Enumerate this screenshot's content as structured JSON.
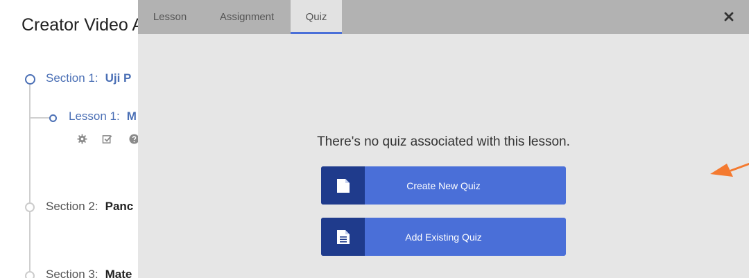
{
  "background": {
    "page_title": "Creator Video A",
    "sections": [
      {
        "label": "Section 1:",
        "name": "Uji P"
      },
      {
        "label": "Section 2:",
        "name": "Panc"
      },
      {
        "label": "Section 3:",
        "name": "Mate"
      }
    ],
    "lesson": {
      "label": "Lesson 1:",
      "name": "M"
    },
    "lesson_tools": [
      "gear-icon",
      "checkbox-icon",
      "help-icon"
    ],
    "accent_color": "#4a6fb5"
  },
  "modal": {
    "tabs": [
      {
        "label": "Lesson",
        "active": false
      },
      {
        "label": "Assignment",
        "active": false
      },
      {
        "label": "Quiz",
        "active": true
      }
    ],
    "close_icon": "close-icon",
    "empty_message": "There's no quiz associated with this lesson.",
    "buttons": {
      "create": {
        "label": "Create New Quiz",
        "icon": "blank-document-icon"
      },
      "add_existing": {
        "label": "Add Existing Quiz",
        "icon": "text-document-icon"
      }
    },
    "colors": {
      "button": "#4a6fd8",
      "button_icon_box": "#1f3b8c",
      "tab_bar": "#b2b2b2",
      "body": "#e6e6e6",
      "annotation_arrow": "#f47a30"
    }
  }
}
